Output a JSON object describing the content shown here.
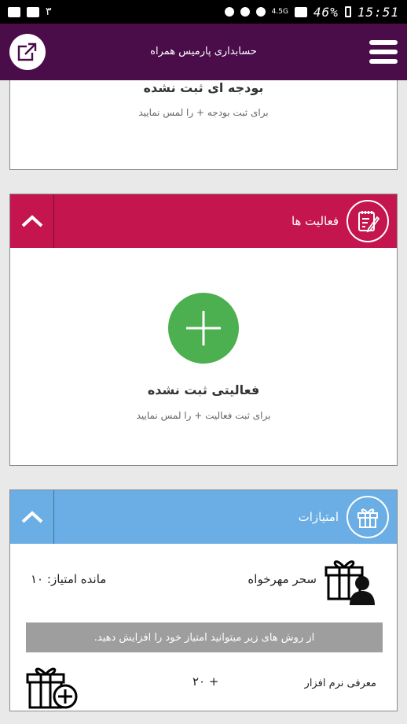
{
  "status_bar": {
    "notification_count": "۳",
    "network": "4.5G",
    "battery": "46%",
    "time": "15:51"
  },
  "app_bar": {
    "title": "حسابداری پارمیس همراه"
  },
  "budget": {
    "empty_title": "بودجه ای ثبت نشده",
    "hint": "برای ثبت بودجه + را لمس نمایید"
  },
  "activities": {
    "header": "فعالیت ها",
    "empty_title": "فعالیتی ثبت نشده",
    "hint": "برای ثبت فعالیت + را لمس نمایید"
  },
  "points": {
    "header": "امتیازات",
    "user_name": "سحر مهرخواه",
    "remaining": "مانده امتیاز: ۱۰",
    "banner": "از روش های زیر میتوانید امتیاز خود را افزایش دهید.",
    "methods": [
      {
        "label": "معرفی نرم افزار",
        "points": "+ ۲۰"
      }
    ]
  },
  "colors": {
    "app_bar": "#4a0d4a",
    "activities_header": "#c4154f",
    "points_header": "#6aaee5",
    "fab": "#4caf50"
  }
}
